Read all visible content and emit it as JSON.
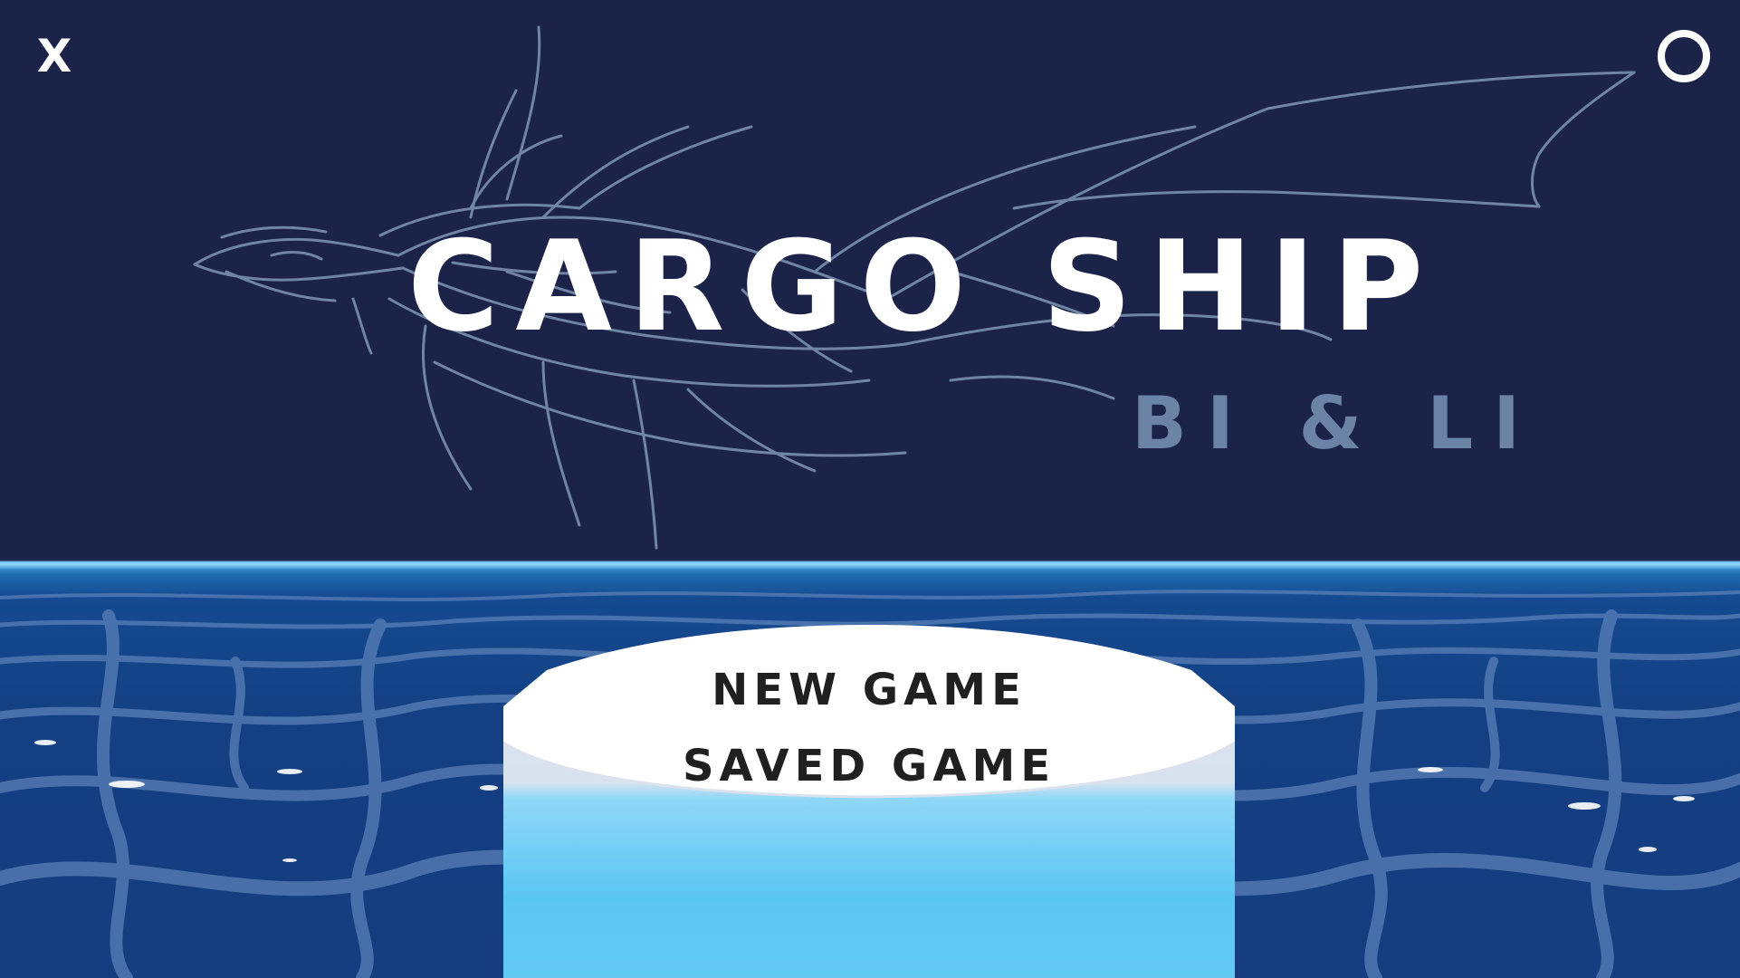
{
  "window": {
    "close_icon": "close-icon",
    "menu_icon": "circle-menu-icon",
    "close_label": "X"
  },
  "title": {
    "main": "CARGO SHIP",
    "sub": "BI & LI"
  },
  "menu": {
    "items": [
      {
        "label": "NEW GAME"
      },
      {
        "label": "SAVED GAME"
      }
    ]
  },
  "colors": {
    "sky": "#1b2349",
    "ocean": "#153d80",
    "title": "#ffffff",
    "subtitle": "#6b84a6",
    "sketch": "#7f97b6",
    "pedestal_top": "#ffffff",
    "pedestal_side": "#5cc6f2"
  }
}
